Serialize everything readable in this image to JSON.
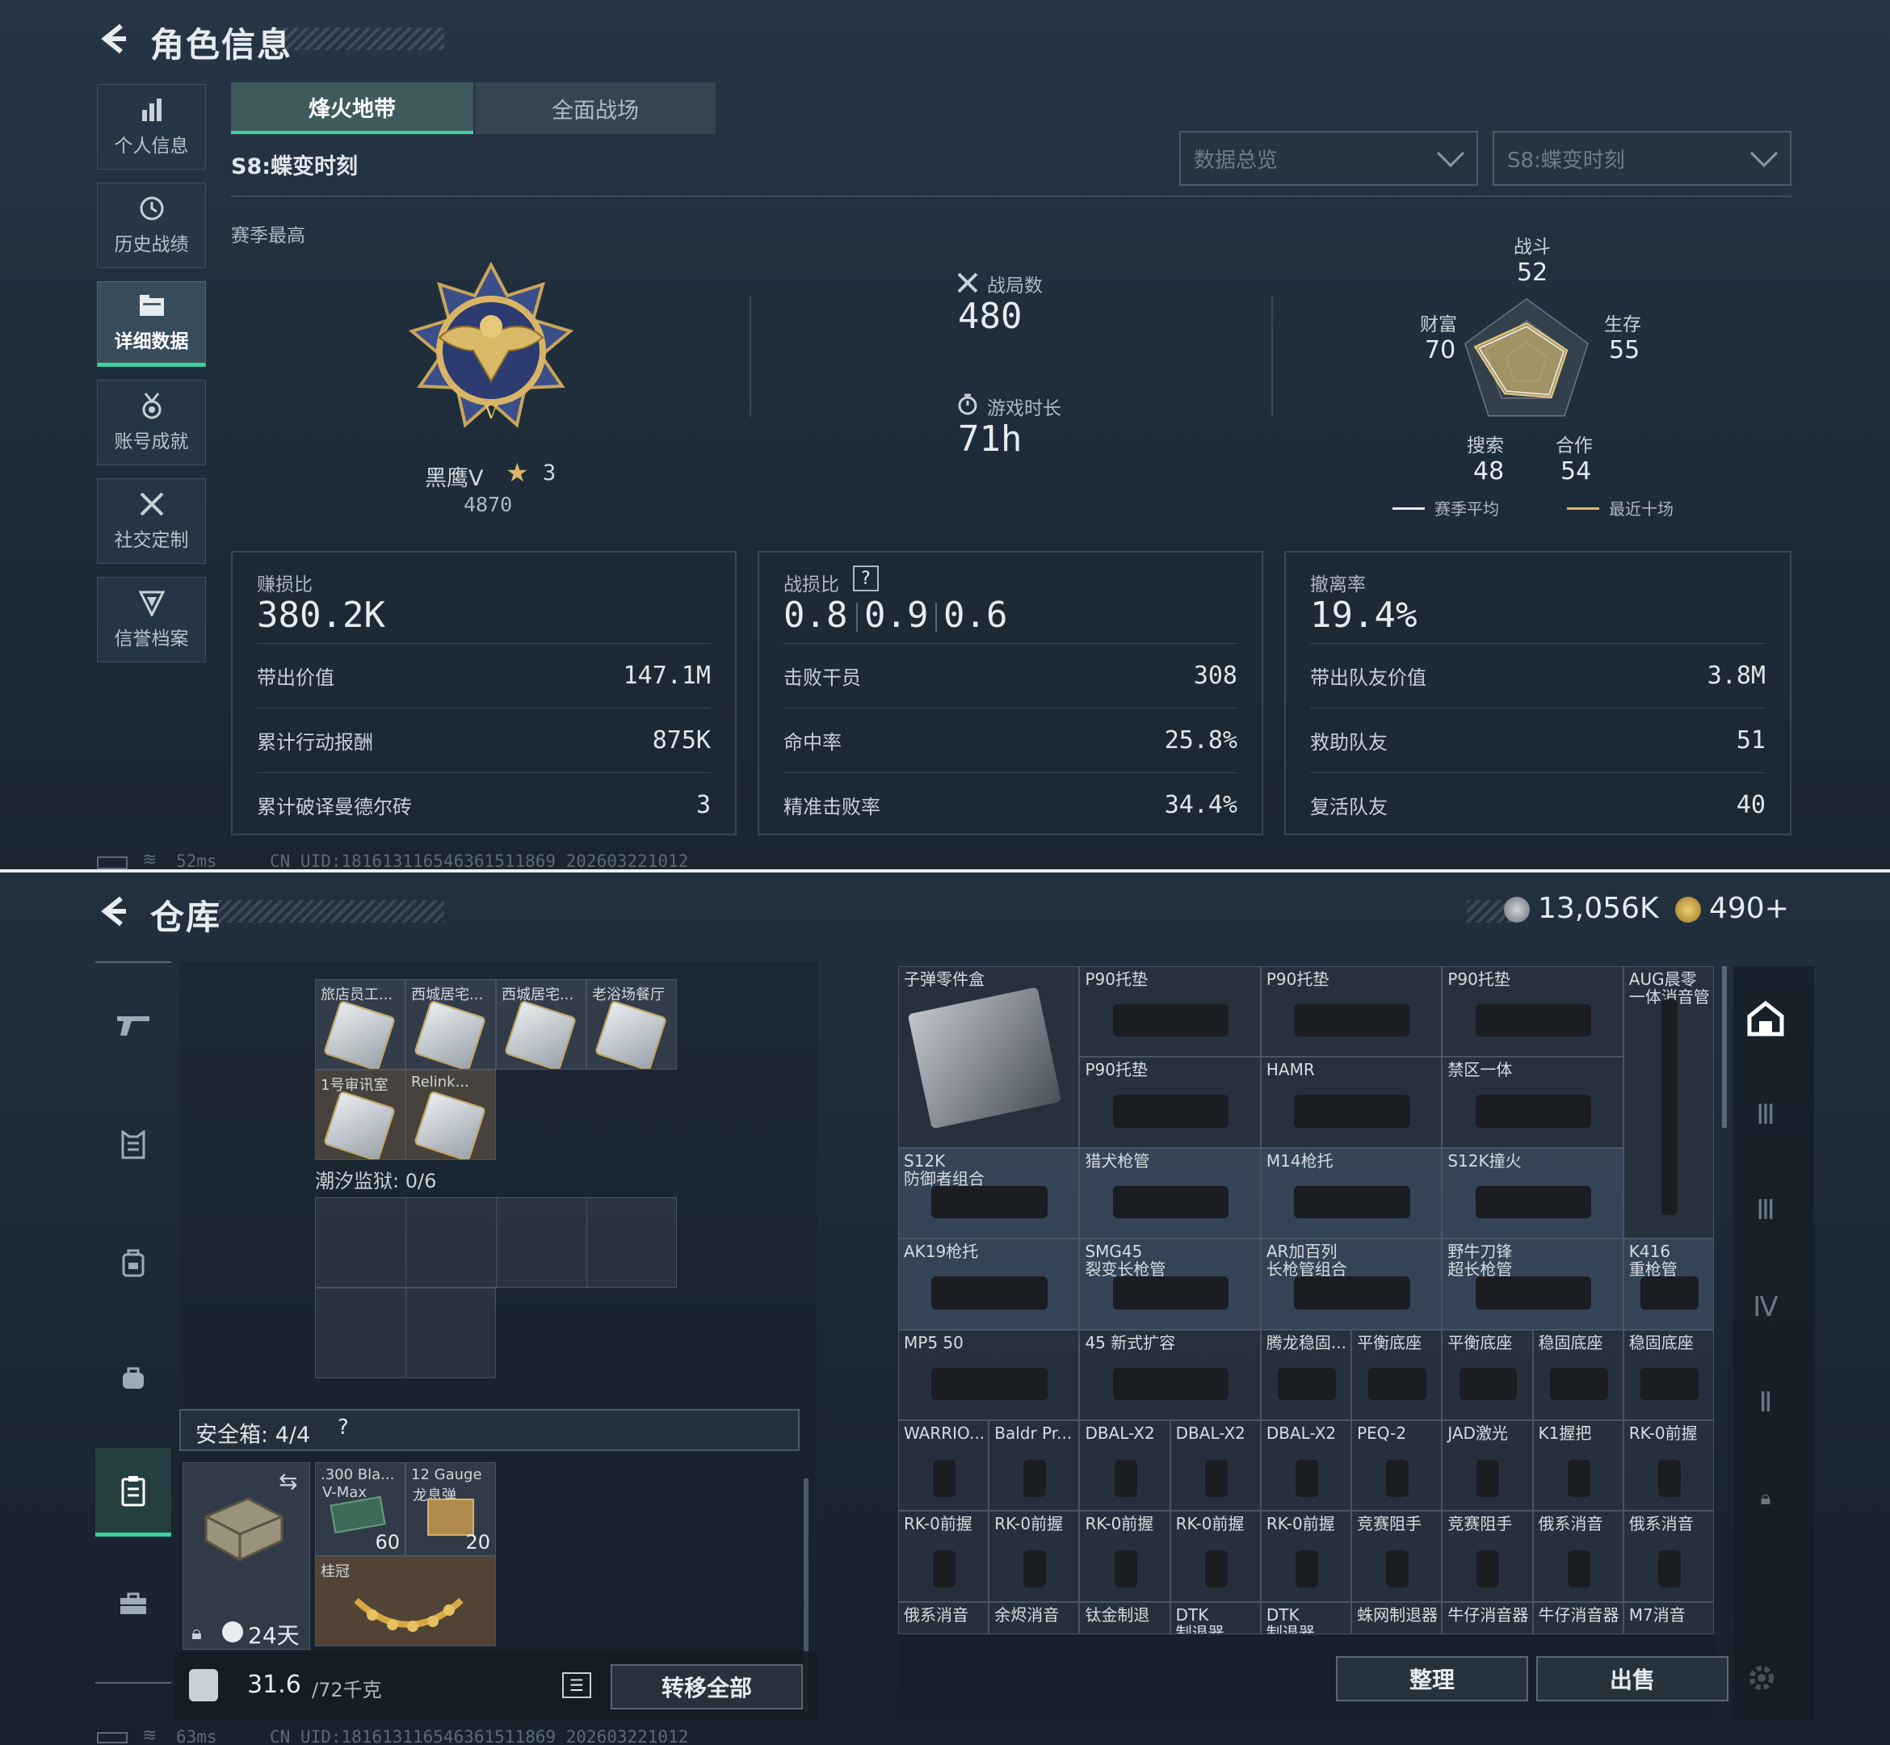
{
  "top": {
    "title": "角色信息",
    "nav": [
      {
        "label": "个人信息",
        "icon": "bar-chart-icon"
      },
      {
        "label": "历史战绩",
        "icon": "history-icon"
      },
      {
        "label": "详细数据",
        "icon": "folder-icon"
      },
      {
        "label": "账号成就",
        "icon": "medal-icon"
      },
      {
        "label": "社交定制",
        "icon": "tools-icon"
      },
      {
        "label": "信誉档案",
        "icon": "shield-icon"
      }
    ],
    "tabs": [
      "烽火地带",
      "全面战场"
    ],
    "season_label": "S8:蝶变时刻",
    "select_overview": "数据总览",
    "select_season": "S8:蝶变时刻",
    "season_best": "赛季最高",
    "rank_name": "黑鹰V",
    "rank_stars": "3",
    "rank_points": "4870",
    "matches_label": "战局数",
    "matches_value": "480",
    "playtime_label": "游戏时长",
    "playtime_value": "71h",
    "radar": {
      "combat_label": "战斗",
      "combat": "52",
      "survival_label": "生存",
      "survival": "55",
      "coop_label": "合作",
      "coop": "54",
      "search_label": "搜索",
      "search": "48",
      "wealth_label": "财富",
      "wealth": "70",
      "legend_avg": "赛季平均",
      "legend_recent": "最近十场",
      "values": [
        52,
        55,
        54,
        48,
        70
      ]
    },
    "card1": {
      "head_label": "赚损比",
      "head_value": "380.2K",
      "rows": [
        {
          "k": "带出价值",
          "v": "147.1M"
        },
        {
          "k": "累计行动报酬",
          "v": "875K"
        },
        {
          "k": "累计破译曼德尔砖",
          "v": "3"
        }
      ]
    },
    "card2": {
      "head_label": "战损比",
      "help": "?",
      "ratios": [
        "0.8",
        "0.9",
        "0.6"
      ],
      "rows": [
        {
          "k": "击败干员",
          "v": "308"
        },
        {
          "k": "命中率",
          "v": "25.8%"
        },
        {
          "k": "精准击败率",
          "v": "34.4%"
        }
      ]
    },
    "card3": {
      "head_label": "撤离率",
      "head_value": "19.4%",
      "rows": [
        {
          "k": "带出队友价值",
          "v": "3.8M"
        },
        {
          "k": "救助队友",
          "v": "51"
        },
        {
          "k": "复活队友",
          "v": "40"
        }
      ]
    },
    "ping": "52ms",
    "uid": "CN UID:181613116546361511869_202603221012"
  },
  "bottom": {
    "title": "仓库",
    "currency1": "13,056K",
    "currency2": "490+",
    "keys": [
      "旅店员工...",
      "西城居宅...",
      "西城居宅...",
      "老浴场餐厅",
      "1号审讯室",
      "Relink..."
    ],
    "prison_label": "潮汐监狱: 0/6",
    "safe_label": "安全箱: 4/4",
    "safe_help": "?",
    "safe_timer": "24天",
    "ammo1": {
      "name": ".300 Bla...",
      "sub": "V-Max",
      "count": "60"
    },
    "ammo2": {
      "name": "12 Gauge",
      "sub": "龙息弹",
      "count": "20"
    },
    "crown": "桂冠",
    "weight": "31.6",
    "weight_max": "/72千克",
    "transfer": "转移全部",
    "sort": "整理",
    "sell": "出售",
    "ping": "63ms",
    "uid": "CN UID:181613116546361511869_202603221012",
    "items": [
      "子弹零件盒",
      "P90托垫",
      "P90托垫",
      "P90托垫",
      "AUG晨零\n一体消音管",
      "P90托垫",
      "HAMR",
      "禁区一体",
      "S12K\n防御者组合",
      "猎犬枪管",
      "M14枪托",
      "S12K撞火",
      "K416\n重枪管",
      "AK19枪托",
      "SMG45\n裂变长枪管",
      "AR加百列\n长枪管组合",
      "野牛刀锋\n超长枪管",
      "MP5 50",
      "45 新式扩容",
      "腾龙稳固...",
      "平衡底座",
      "平衡底座",
      "稳固底座",
      "稳固底座",
      "WARRIO...",
      "Baldr Pr...",
      "DBAL-X2",
      "DBAL-X2",
      "DBAL-X2",
      "PEQ-2",
      "JAD激光",
      "K1握把",
      "RK-0前握",
      "RK-0前握",
      "RK-0前握",
      "RK-0前握",
      "RK-0前握",
      "RK-0前握",
      "竞赛阻手",
      "竞赛阻手",
      "俄系消音",
      "俄系消音",
      "俄系消音",
      "余烬消音",
      "钛金制退",
      "DTK\n制退器",
      "DTK\n制退器",
      "蛛网制退器",
      "牛仔消音器",
      "牛仔消音器",
      "M7消音"
    ]
  }
}
